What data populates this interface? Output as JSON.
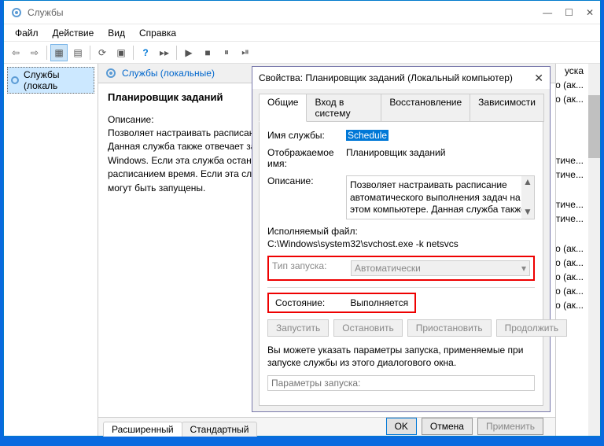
{
  "mainWindow": {
    "title": "Службы",
    "menu": {
      "file": "Файл",
      "action": "Действие",
      "view": "Вид",
      "help": "Справка"
    },
    "winControls": {
      "min": "—",
      "max": "☐",
      "close": "✕"
    }
  },
  "leftTree": {
    "root": "Службы (локаль"
  },
  "midPanel": {
    "header": "Службы (локальные)",
    "serviceName": "Планировщик заданий",
    "descLabel": "Описание:",
    "description": "Позволяет настраивать расписание автоматического выполнения задач на этом компьютере. Данная служба также отвечает за выполнение нескольких критически важных системных задач Windows. Если эта служба остановлена, эти задачи не могут быть запущены в установленное расписанием время. Если эта служба отключена, любые службы, которые явно зависят от нее, не могут быть запущены.",
    "tabs": {
      "extended": "Расширенный",
      "standard": "Стандартный"
    }
  },
  "rightList": {
    "items": [
      "уска",
      "о (ак...",
      "о (ак...",
      "тиче...",
      "тиче...",
      "тиче...",
      "тиче...",
      "о (ак...",
      "о (ак...",
      "о (ак...",
      "о (ак...",
      "о (ак..."
    ]
  },
  "dialog": {
    "title": "Свойства: Планировщик заданий (Локальный компьютер)",
    "close": "✕",
    "tabs": {
      "general": "Общие",
      "logon": "Вход в систему",
      "recovery": "Восстановление",
      "deps": "Зависимости"
    },
    "fields": {
      "serviceNameLabel": "Имя службы:",
      "serviceName": "Schedule",
      "displayNameLabel": "Отображаемое имя:",
      "displayName": "Планировщик заданий",
      "descLabel": "Описание:",
      "description": "Позволяет настраивать расписание автоматического выполнения задач на этом компьютере. Данная служба также отвечает за выполнение нескольких критически важных",
      "exeLabel": "Исполняемый файл:",
      "exePath": "C:\\Windows\\system32\\svchost.exe -k netsvcs",
      "startupLabel": "Тип запуска:",
      "startupValue": "Автоматически",
      "stateLabel": "Состояние:",
      "stateValue": "Выполняется",
      "paramHint": "Вы можете указать параметры запуска, применяемые при запуске службы из этого диалогового окна.",
      "paramLabel": "Параметры запуска:"
    },
    "buttons": {
      "start": "Запустить",
      "stop": "Остановить",
      "pause": "Приостановить",
      "resume": "Продолжить",
      "ok": "OK",
      "cancel": "Отмена",
      "apply": "Применить"
    }
  }
}
